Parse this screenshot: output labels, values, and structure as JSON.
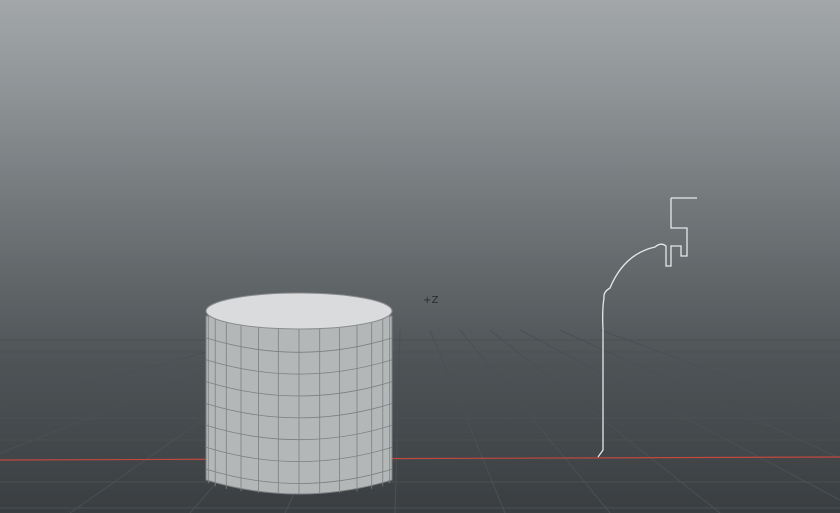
{
  "viewport": {
    "axis_label": "+Z",
    "colors": {
      "background_top": "#a3a7a9",
      "background_bottom": "#3a3e41",
      "grid_line": "#4a5053",
      "x_axis": "#c0483e",
      "mesh_side": "#b7b9ba",
      "mesh_top": "#d9dadb",
      "mesh_wire": "#7c7f81",
      "curve": "#e6e8ea"
    },
    "objects": [
      {
        "type": "cylinder-mesh",
        "name": "cylinder"
      },
      {
        "type": "profile-curve",
        "name": "profile-curve"
      }
    ]
  }
}
